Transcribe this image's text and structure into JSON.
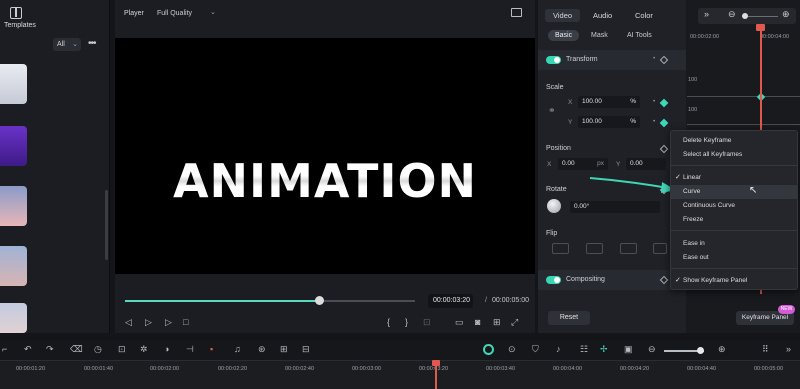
{
  "templates": {
    "label": "Templates",
    "filter_value": "All",
    "thumb_colors": [
      "#d8dbe5",
      "#5a2bb2",
      "#d6a3b6",
      "#a9b8d0",
      "#c9d3e4"
    ]
  },
  "player": {
    "label": "Player",
    "quality": "Full Quality",
    "preview_text": "ANIMATION",
    "current_time": "00:00:03:20",
    "separator": "/",
    "total_time": "00:00:05:00",
    "progress": 0.67
  },
  "props": {
    "tabs": [
      "Video",
      "Audio",
      "Color"
    ],
    "subtabs": [
      "Basic",
      "Mask",
      "AI Tools"
    ],
    "transform_label": "Transform",
    "scale_label": "Scale",
    "scale_x_label": "X",
    "scale_x": "100.00",
    "scale_y_label": "Y",
    "scale_y": "100.00",
    "unit_pct": "%",
    "position_label": "Position",
    "pos_x_label": "X",
    "pos_x": "0.00",
    "pos_y_label": "Y",
    "pos_y": "0.00",
    "unit_px": "px",
    "rotate_label": "Rotate",
    "rotate_value": "0.00°",
    "flip_label": "Flip",
    "compositing_label": "Compositing",
    "reset_label": "Reset"
  },
  "keyframe_graph": {
    "ruler_ticks": [
      "00:00:02:00",
      "00:00:04:00"
    ],
    "scale_marks": [
      "100",
      "100"
    ]
  },
  "context_menu": {
    "items_group1": [
      "Delete Keyframe",
      "Select all Keyframes"
    ],
    "items_group2": [
      "Linear",
      "Curve",
      "Continuous Curve",
      "Freeze"
    ],
    "items_group3": [
      "Ease in",
      "Ease out"
    ],
    "items_group4": [
      "Show Keyframe Panel"
    ],
    "checked": [
      "Linear",
      "Show Keyframe Panel"
    ],
    "highlighted": "Curve"
  },
  "keyframe_panel_button": "Keyframe Panel",
  "new_badge": "NEW",
  "timeline": {
    "ticks": [
      "00:00:01:20",
      "00:00:01:40",
      "00:00:02:00",
      "00:00:02:20",
      "00:00:02:40",
      "00:00:03:00",
      "00:00:03:20",
      "00:00:03:40",
      "00:00:04:00",
      "00:00:04:20",
      "00:00:04:40",
      "00:00:05:00"
    ]
  },
  "colors": {
    "accent": "#3fd6b8",
    "playhead": "#e1584f"
  }
}
